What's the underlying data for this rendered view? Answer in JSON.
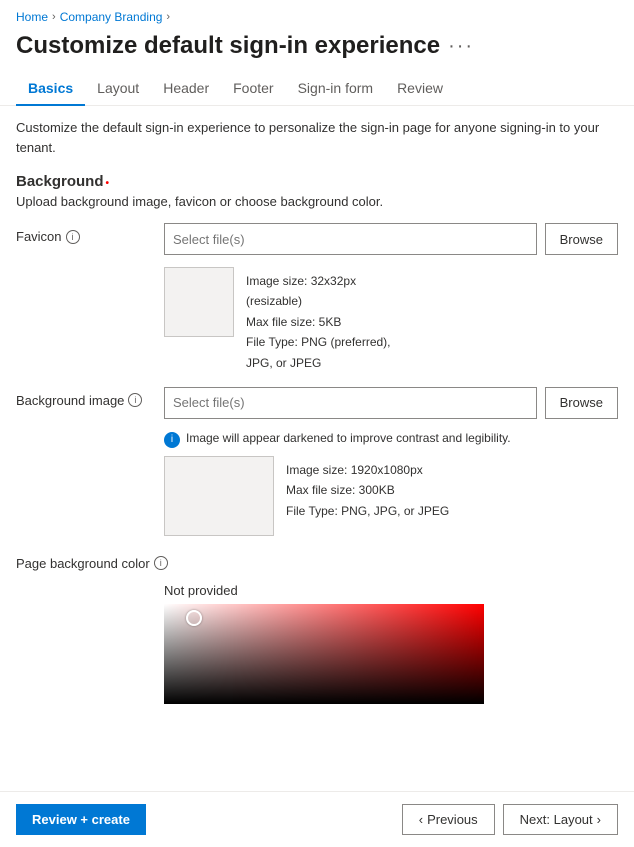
{
  "breadcrumb": {
    "home": "Home",
    "company_branding": "Company Branding",
    "chevron": "›"
  },
  "page": {
    "title": "Customize default sign-in experience",
    "more_label": "···"
  },
  "tabs": [
    {
      "id": "basics",
      "label": "Basics",
      "active": true
    },
    {
      "id": "layout",
      "label": "Layout",
      "active": false
    },
    {
      "id": "header",
      "label": "Header",
      "active": false
    },
    {
      "id": "footer",
      "label": "Footer",
      "active": false
    },
    {
      "id": "signin-form",
      "label": "Sign-in form",
      "active": false
    },
    {
      "id": "review",
      "label": "Review",
      "active": false
    }
  ],
  "description": "Customize the default sign-in experience to personalize the sign-in page for anyone signing-in to your tenant.",
  "background_section": {
    "title": "Background",
    "upload_description": "Upload background image, favicon or choose background color."
  },
  "favicon": {
    "label": "Favicon",
    "placeholder": "Select file(s)",
    "browse_label": "Browse",
    "image_size": "Image size: 32x32px",
    "resizable": "(resizable)",
    "max_file_size": "Max file size: 5KB",
    "file_type": "File Type: PNG (preferred),",
    "file_type2": "JPG, or JPEG"
  },
  "background_image": {
    "label": "Background image",
    "placeholder": "Select file(s)",
    "browse_label": "Browse",
    "info_text": "Image will appear darkened to improve contrast and legibility.",
    "image_size": "Image size: 1920x1080px",
    "max_file_size": "Max file size: 300KB",
    "file_type": "File Type: PNG, JPG, or JPEG"
  },
  "page_background_color": {
    "label": "Page background color",
    "not_provided": "Not provided"
  },
  "footer": {
    "review_create_label": "Review + create",
    "previous_label": "< Previous",
    "next_label": "Next: Layout >",
    "prev_chevron": "‹",
    "next_chevron": "›"
  }
}
